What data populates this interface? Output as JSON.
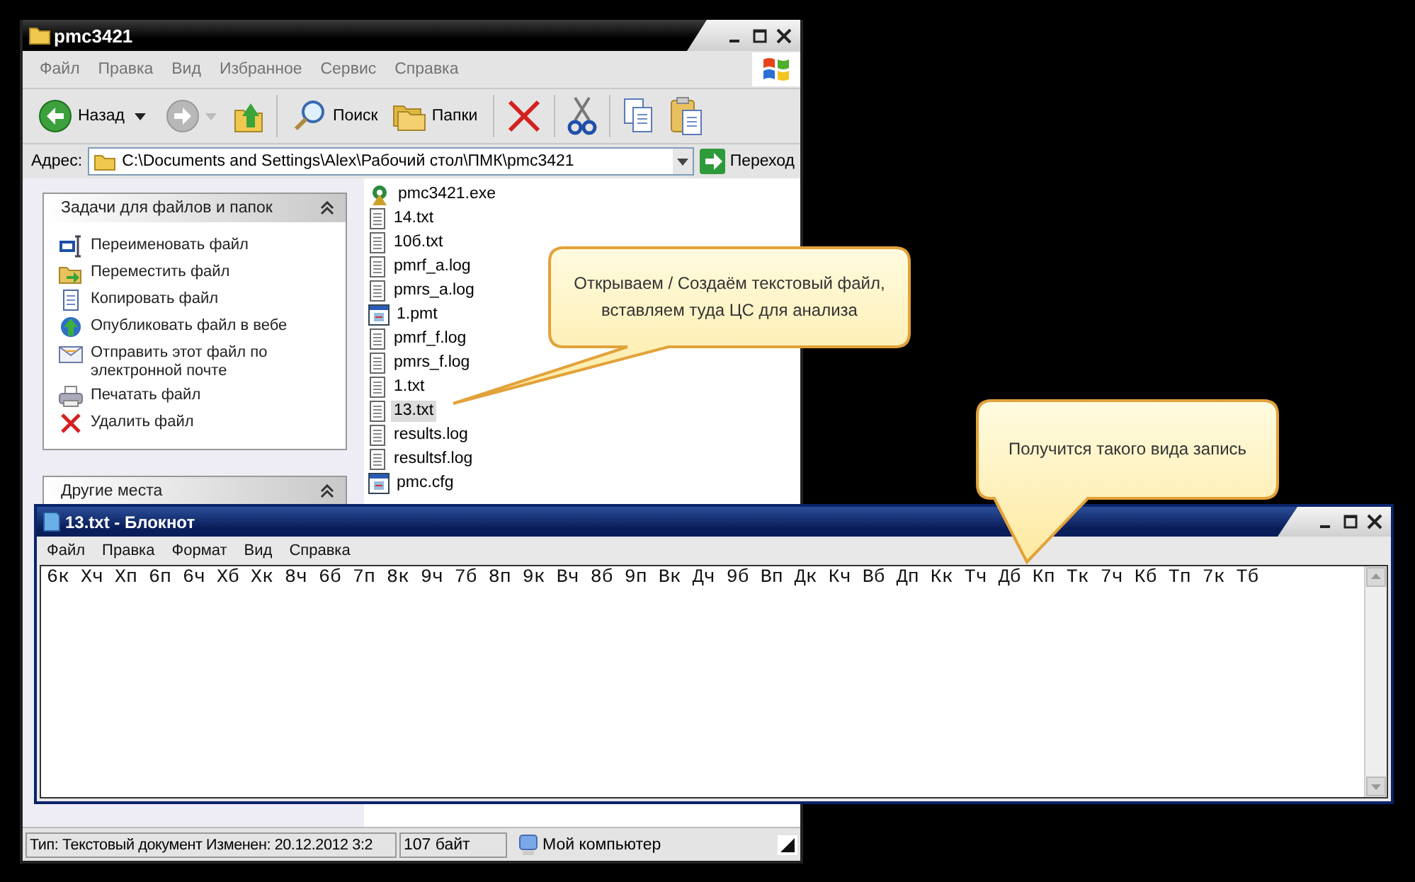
{
  "explorer": {
    "title": "pmc3421",
    "menu": [
      "Файл",
      "Правка",
      "Вид",
      "Избранное",
      "Сервис",
      "Справка"
    ],
    "toolbar": {
      "back": "Назад",
      "search": "Поиск",
      "folders": "Папки"
    },
    "address": {
      "label": "Адрес:",
      "value": "C:\\Documents and Settings\\Alex\\Рабочий стол\\ПМК\\pmc3421",
      "go": "Переход"
    },
    "task_panels": [
      {
        "title": "Задачи для файлов и папок",
        "expanded": true,
        "items": [
          "Переименовать файл",
          "Переместить файл",
          "Копировать файл",
          "Опубликовать файл в вебе",
          "Отправить этот файл по электронной почте",
          "Печатать файл",
          "Удалить файл"
        ]
      },
      {
        "title": "Другие места",
        "expanded": true
      }
    ],
    "files": [
      {
        "name": "pmc3421.exe",
        "kind": "program",
        "selected": false
      },
      {
        "name": "14.txt",
        "kind": "text",
        "selected": false
      },
      {
        "name": "10б.txt",
        "kind": "text",
        "selected": false
      },
      {
        "name": "pmrf_a.log",
        "kind": "text",
        "selected": false
      },
      {
        "name": "pmrs_a.log",
        "kind": "text",
        "selected": false
      },
      {
        "name": "1.pmt",
        "kind": "settings",
        "selected": false
      },
      {
        "name": "pmrf_f.log",
        "kind": "text",
        "selected": false
      },
      {
        "name": "pmrs_f.log",
        "kind": "text",
        "selected": false
      },
      {
        "name": "1.txt",
        "kind": "text",
        "selected": false
      },
      {
        "name": "13.txt",
        "kind": "text",
        "selected": true
      },
      {
        "name": "results.log",
        "kind": "text",
        "selected": false
      },
      {
        "name": "resultsf.log",
        "kind": "text",
        "selected": false
      },
      {
        "name": "pmc.cfg",
        "kind": "settings",
        "selected": false
      }
    ],
    "status_bar": [
      "Тип: Текстовый документ Изменен: 20.12.2012 3:2",
      "107 байт",
      "Мой компьютер"
    ]
  },
  "notepad": {
    "title": "13.txt - Блокнот",
    "menu": [
      "Файл",
      "Правка",
      "Формат",
      "Вид",
      "Справка"
    ],
    "text": "6к Хч Хп 6п 6ч Хб Хк 8ч 6б 7п 8к 9ч 7б 8п 9к Вч 8б 9п Вк Дч 9б Вп Дк Кч Вб Дп Кк Тч Дб Кп Тк 7ч Кб Тп 7к Тб"
  },
  "callouts": [
    {
      "text": "Открываем / Создаём текстовый файл, вставляем туда ЦС для анализа"
    },
    {
      "text": "Получится такого вида запись"
    }
  ]
}
